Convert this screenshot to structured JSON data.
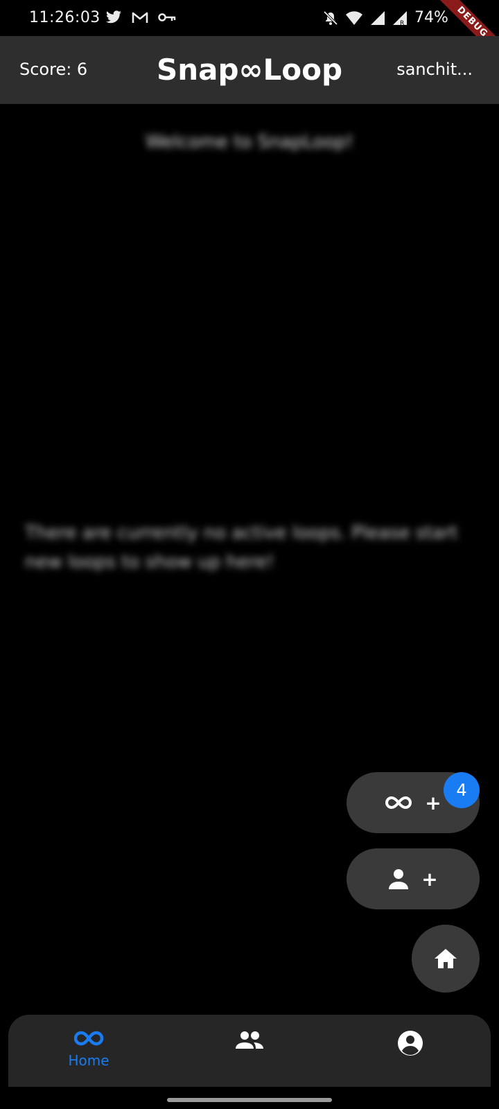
{
  "status_bar": {
    "time": "11:26:03",
    "battery": "74%",
    "debug_label": "DEBUG",
    "left_icons": [
      "twitter-icon",
      "gmail-icon",
      "key-icon"
    ],
    "right_icons": [
      "notifications-off-icon",
      "wifi-icon",
      "signal-icon",
      "signal-roaming-icon"
    ]
  },
  "app_bar": {
    "score": "Score: 6",
    "title": "Snap∞Loop",
    "username": "sanchit..."
  },
  "main": {
    "welcome": "Welcome to SnapLoop!",
    "empty_message": "There are currently no active loops. Please start new loops to show up here!"
  },
  "fabs": {
    "new_loop_plus": "+",
    "add_friend_plus": "+",
    "badge_count": "4"
  },
  "bottom_nav": {
    "items": [
      {
        "label": "Home",
        "icon": "infinity-icon",
        "active": true
      },
      {
        "label": "",
        "icon": "people-icon",
        "active": false
      },
      {
        "label": "",
        "icon": "account-circle-icon",
        "active": false
      }
    ]
  },
  "colors": {
    "accent": "#1a7cf2",
    "app_bar": "#2e2e2e",
    "fab": "#3a3a3a",
    "nav": "#262626",
    "background": "#000000"
  }
}
